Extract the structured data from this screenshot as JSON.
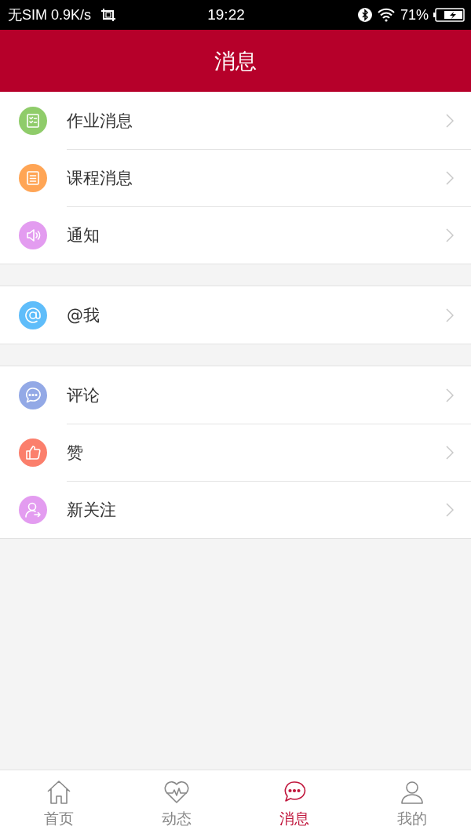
{
  "status_bar": {
    "carrier": "无SIM 0.9K/s",
    "time": "19:22",
    "battery": "71%"
  },
  "header": {
    "title": "消息"
  },
  "groups": [
    {
      "items": [
        {
          "kind": "homework",
          "label": "作业消息",
          "color": "#8fcc6a"
        },
        {
          "kind": "course",
          "label": "课程消息",
          "color": "#ffa555"
        },
        {
          "kind": "notice",
          "label": "通知",
          "color": "#e39cf0"
        }
      ]
    },
    {
      "items": [
        {
          "kind": "mention",
          "label": "@我",
          "color": "#5fbdfa"
        }
      ]
    },
    {
      "items": [
        {
          "kind": "comment",
          "label": "评论",
          "color": "#93a9e6"
        },
        {
          "kind": "like",
          "label": "赞",
          "color": "#fb7f6c"
        },
        {
          "kind": "follow",
          "label": "新关注",
          "color": "#e39cf0"
        }
      ]
    }
  ],
  "tabs": [
    {
      "kind": "home",
      "label": "首页",
      "selected": false
    },
    {
      "kind": "activity",
      "label": "动态",
      "selected": false
    },
    {
      "kind": "messages",
      "label": "消息",
      "selected": true
    },
    {
      "kind": "profile",
      "label": "我的",
      "selected": false
    }
  ]
}
